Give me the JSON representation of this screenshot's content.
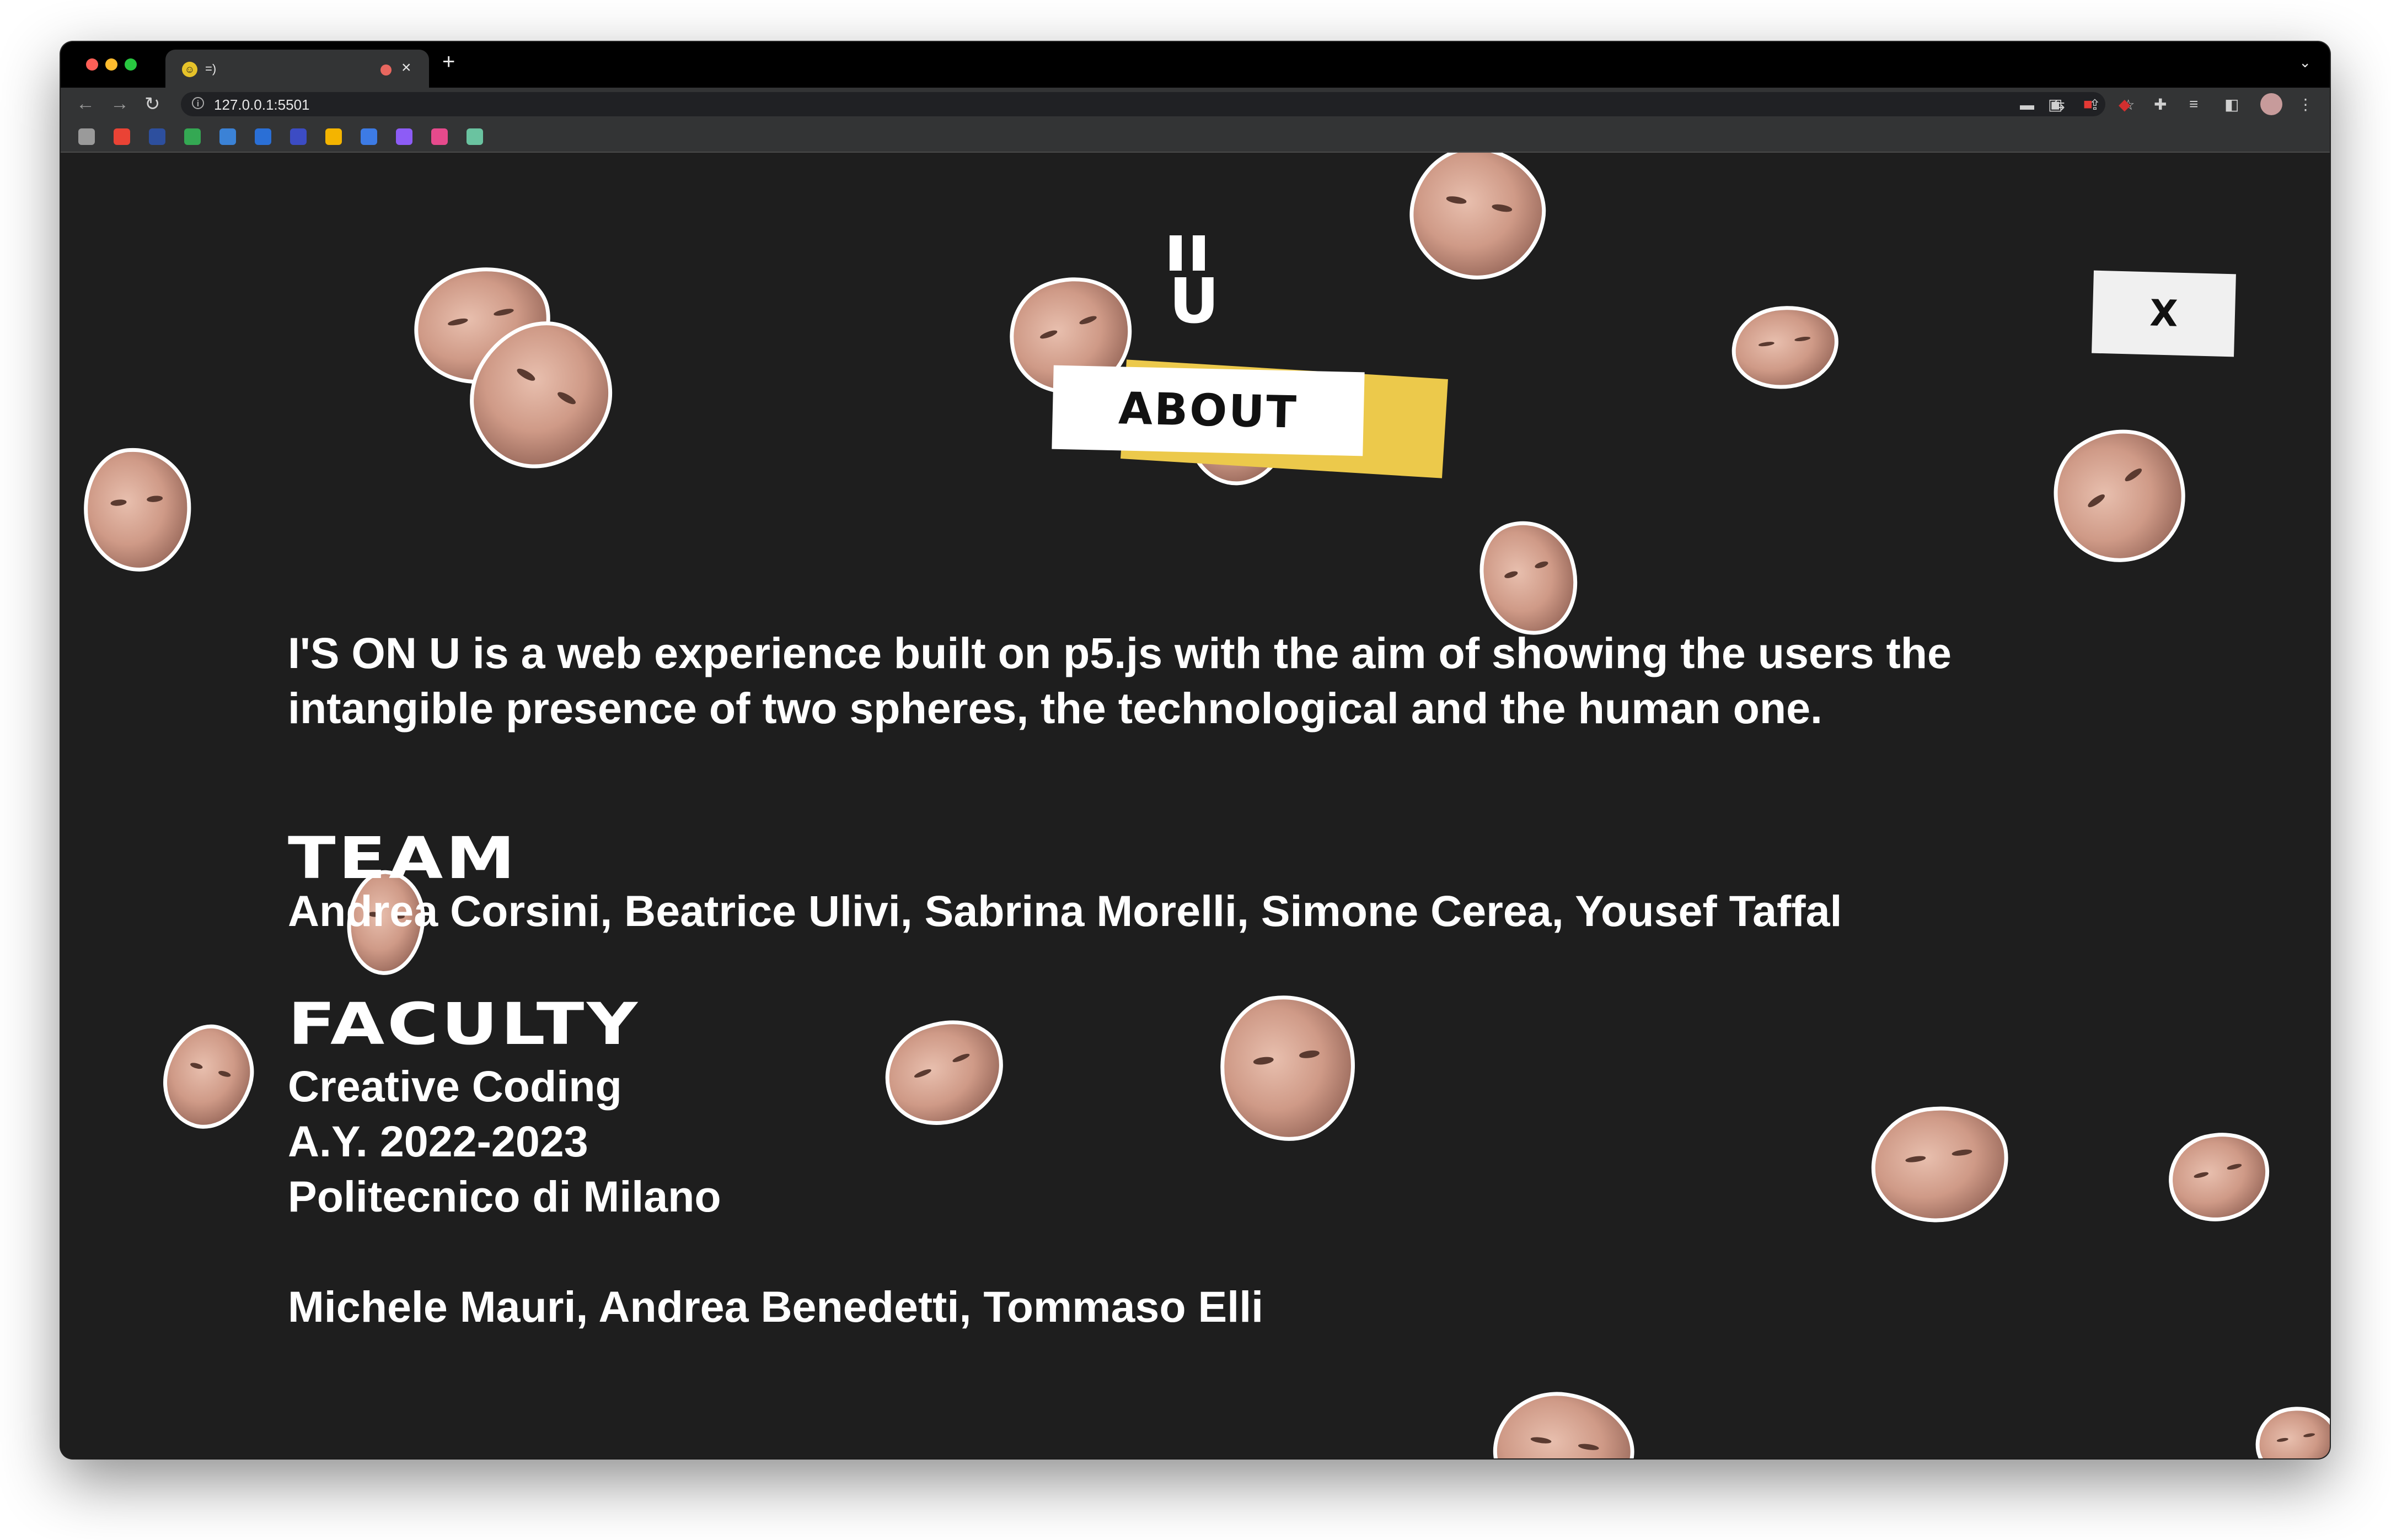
{
  "browser": {
    "tab": {
      "favicon": "smiley-favicon",
      "title": "=)"
    },
    "new_tab_label": "+",
    "close_tab_label": "×",
    "tab_menu_label": "⌄",
    "url": "127.0.0.1:5501",
    "nav": {
      "back": "←",
      "forward": "→",
      "reload": "↻"
    },
    "bookmark_colors": [
      "#9a9a9a",
      "#ea4335",
      "#2d4f9e",
      "#34a853",
      "#3b82d6",
      "#2a6fd6",
      "#3c4cc4",
      "#f4b400",
      "#3d7be5",
      "#8d5cf6",
      "#e64a8c",
      "#6ac3a0"
    ]
  },
  "page": {
    "logo_text": "U",
    "about_label": "ABOUT",
    "close_label": "X",
    "intro": "I'S ON U is a web experience built on p5.js with the aim of showing the users the intangible presence of two spheres, the technological and the human one.",
    "team_heading": "TEAM",
    "team_names": "Andrea Corsini, Beatrice Ulivi, Sabrina Morelli, Simone Cerea, Yousef Taffal",
    "faculty_heading": "FACULTY",
    "faculty_lines": [
      "Creative Coding",
      "A.Y. 2022-2023",
      "Politecnico di Milano"
    ],
    "faculty_names": "Michele Mauri, Andrea Benedetti, Tommaso Elli",
    "colors": {
      "background": "#1e1e1e",
      "accent_yellow": "#ecc94b",
      "text": "#ffffff"
    }
  }
}
